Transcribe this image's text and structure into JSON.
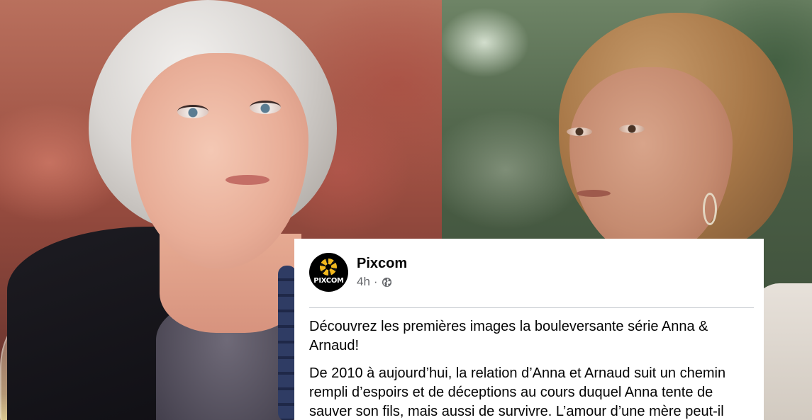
{
  "post": {
    "page_name": "Pixcom",
    "avatar_text": "PIXCOM",
    "time": "4h",
    "separator": "·",
    "visibility_icon": "globe-icon",
    "paragraphs": [
      "Découvrez les premières images la bouleversante série Anna & Arnaud!",
      "De 2010 à aujourd’hui, la relation d’Anna et Arnaud suit un chemin rempli d’espoirs et de déceptions au cours duquel Anna tente de sauver son fils, mais aussi de survivre. L’amour d’une mère peut-il"
    ]
  },
  "colors": {
    "card_background": "#ffffff",
    "text_primary": "#050505",
    "text_secondary": "#65676b",
    "avatar_accent": "#f2b81d"
  }
}
